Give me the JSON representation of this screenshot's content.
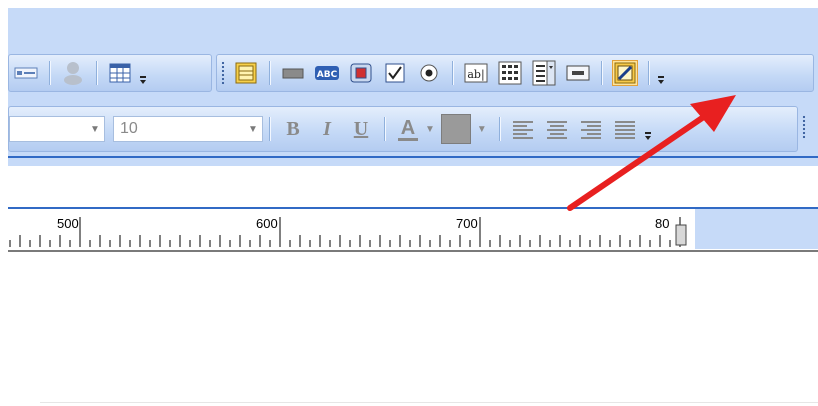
{
  "toolbar1": {
    "icons": [
      "caption-icon",
      "user-icon",
      "table-icon",
      "grid-icon",
      "text-block-icon",
      "abc-label-icon",
      "image-frame-icon",
      "checkbox-icon",
      "radio-icon",
      "textbox-icon",
      "listbox-icon",
      "combobox-icon",
      "button-icon",
      "design-tool-icon"
    ]
  },
  "toolbar2": {
    "font_value": "",
    "size_value": "10",
    "bold_label": "B",
    "italic_label": "I",
    "underline_label": "U",
    "font_color_label": "A"
  },
  "ruler": {
    "labels": [
      "500",
      "600",
      "700",
      "80"
    ]
  },
  "colors": {
    "band": "#c6daf8",
    "arrow": "#e82020",
    "highlight": "#ffe49a",
    "accent_line": "#316ac5"
  }
}
